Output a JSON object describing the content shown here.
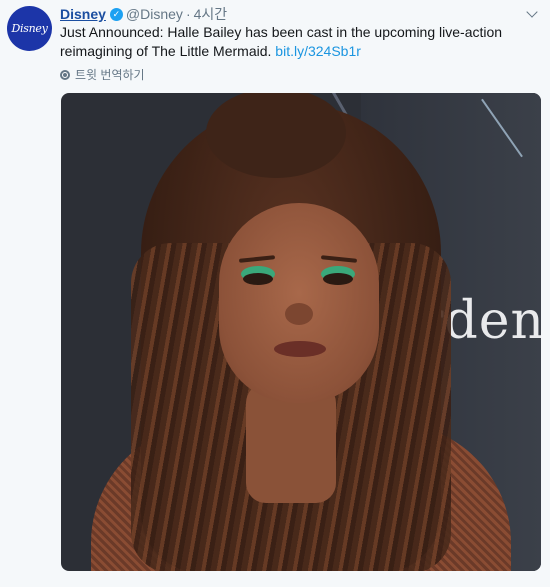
{
  "tweet": {
    "avatar_text": "Disney",
    "display_name": "Disney",
    "verified_glyph": "✓",
    "handle": "@Disney",
    "separator": "·",
    "time": "4시간",
    "body_text": "Just Announced: Halle Bailey has been cast in the upcoming live-action reimagining of The Little Mermaid. ",
    "link_text": "bit.ly/324Sb1r",
    "translate_label": "트윗 번역하기"
  },
  "photo": {
    "background_text": "Arden"
  },
  "icons": {
    "menu": "chevron-down-icon",
    "translate": "globe-icon",
    "verified": "verified-badge-icon"
  },
  "colors": {
    "name": "#1b4ea0",
    "link": "#1b95e0",
    "verified": "#1da1f2",
    "avatar": "#1c35a8",
    "muted": "#657786"
  }
}
